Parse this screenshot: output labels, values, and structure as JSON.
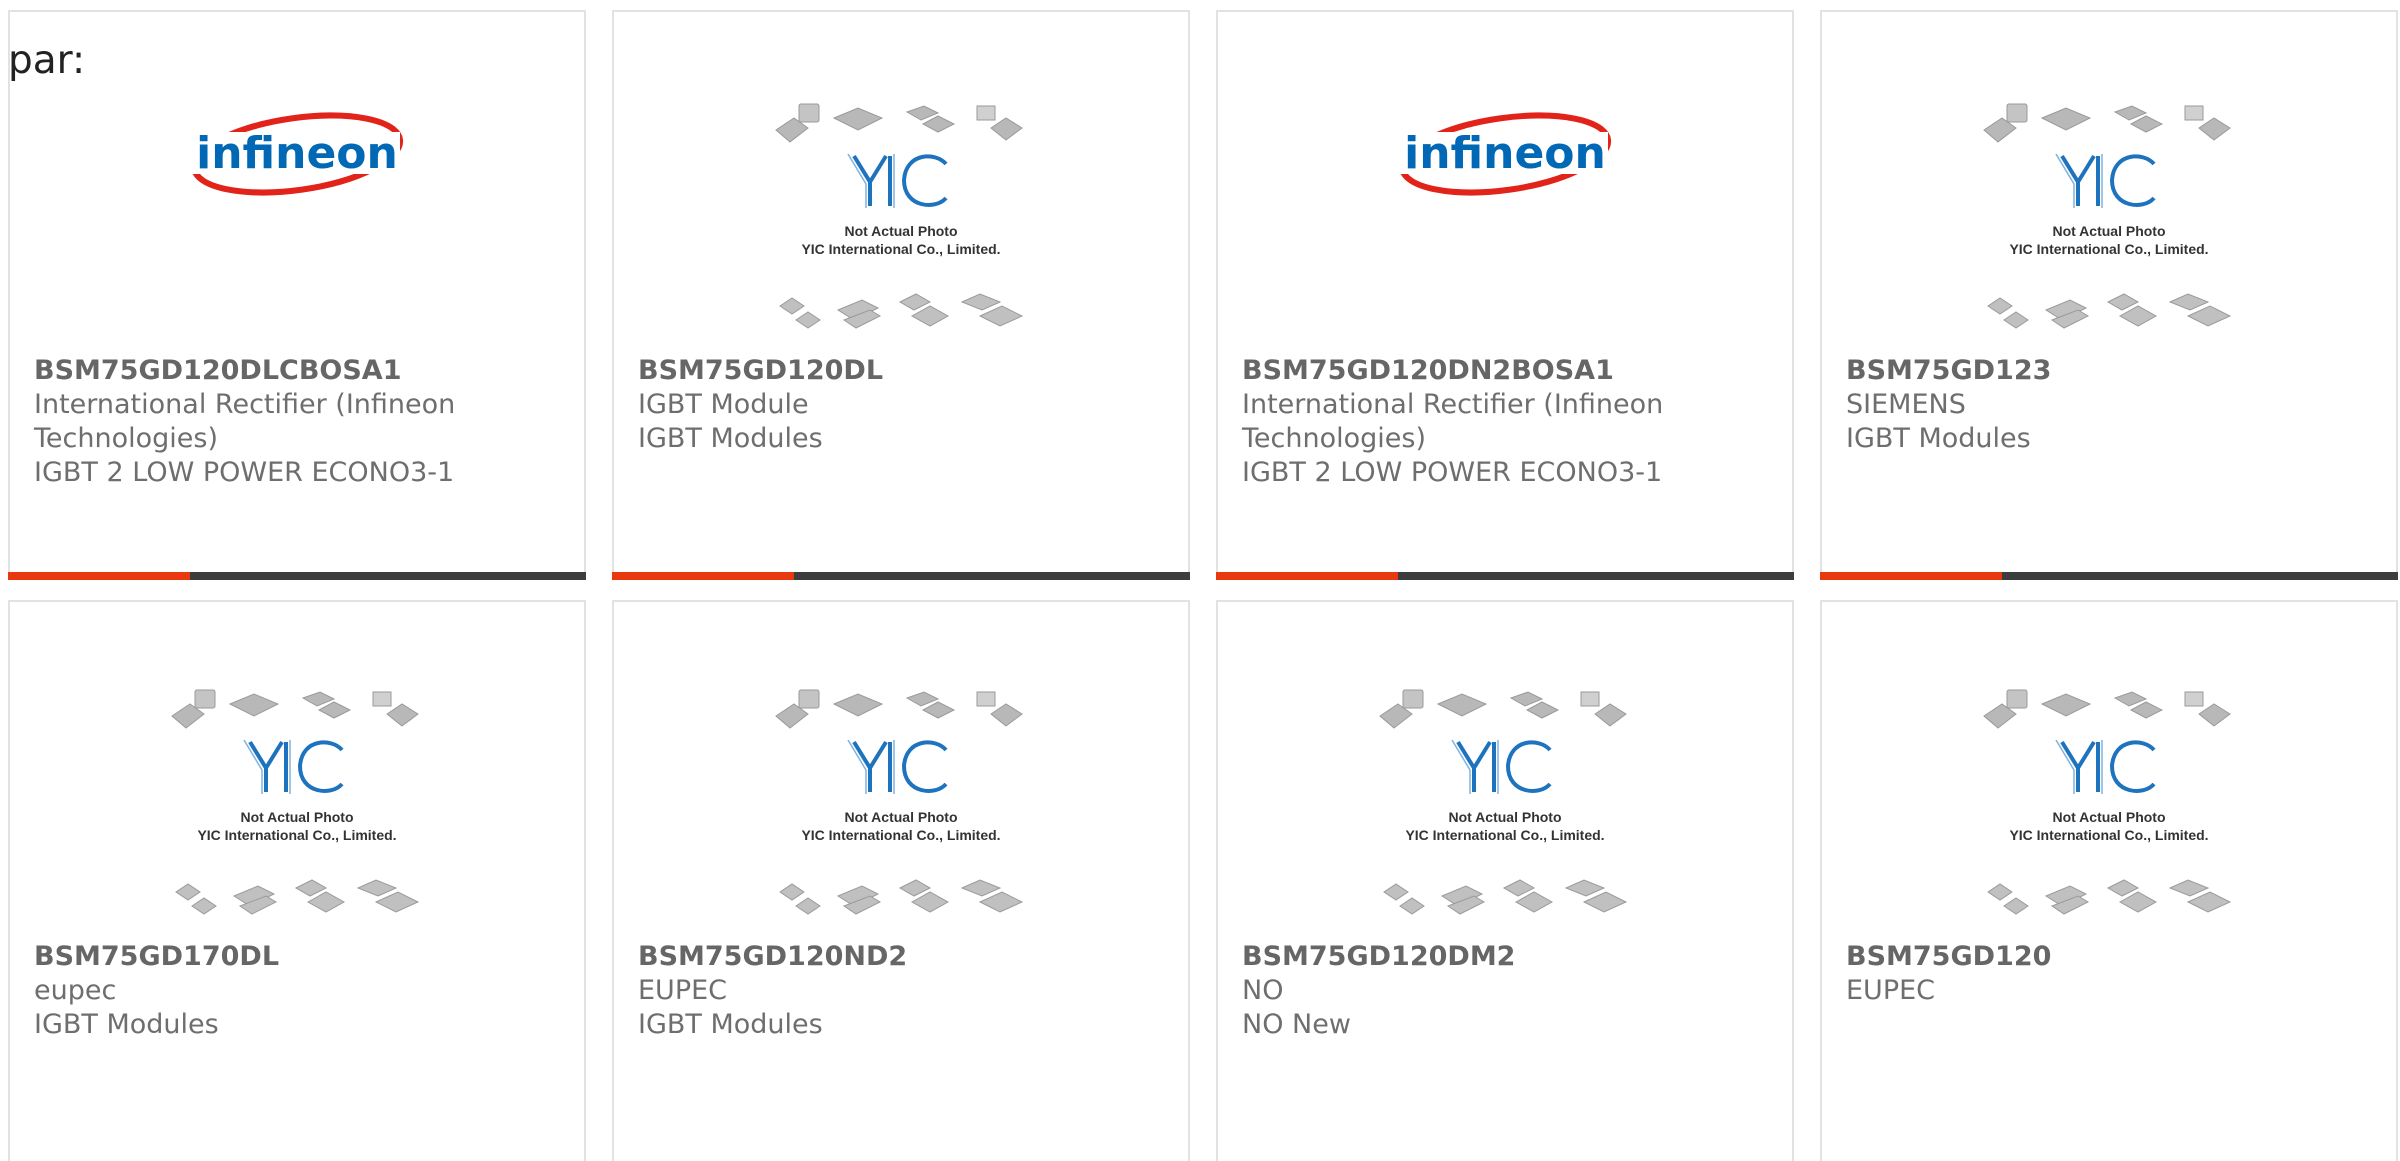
{
  "prefix": "par:",
  "colors": {
    "accent": "#e8380d",
    "bar": "#3d3d3d",
    "infineon_red": "#e2231a",
    "infineon_blue": "#0068b4",
    "yic_blue": "#1e73be"
  },
  "placeholder": {
    "line1": "Not Actual Photo",
    "line2": "YIC International Co., Limited."
  },
  "logo_text": "infineon",
  "products": [
    {
      "part": "BSM75GD120DLCBOSA1",
      "image": "infineon-logo",
      "lines": [
        "International Rectifier (Infineon",
        "Technologies)",
        "IGBT 2 LOW POWER ECONO3-1"
      ]
    },
    {
      "part": "BSM75GD120DL",
      "image": "yic-placeholder",
      "lines": [
        "IGBT Module",
        "IGBT Modules"
      ]
    },
    {
      "part": "BSM75GD120DN2BOSA1",
      "image": "infineon-logo",
      "lines": [
        "International Rectifier (Infineon",
        "Technologies)",
        "IGBT 2 LOW POWER ECONO3-1"
      ]
    },
    {
      "part": "BSM75GD123",
      "image": "yic-placeholder",
      "lines": [
        "SIEMENS",
        "IGBT Modules"
      ]
    },
    {
      "part": "BSM75GD170DL",
      "image": "yic-placeholder",
      "lines": [
        "eupec",
        "IGBT Modules"
      ]
    },
    {
      "part": "BSM75GD120ND2",
      "image": "yic-placeholder",
      "lines": [
        "EUPEC",
        "IGBT Modules"
      ]
    },
    {
      "part": "BSM75GD120DM2",
      "image": "yic-placeholder",
      "lines": [
        "NO",
        "NO New"
      ]
    },
    {
      "part": "BSM75GD120",
      "image": "yic-placeholder",
      "lines": [
        "EUPEC"
      ]
    }
  ]
}
